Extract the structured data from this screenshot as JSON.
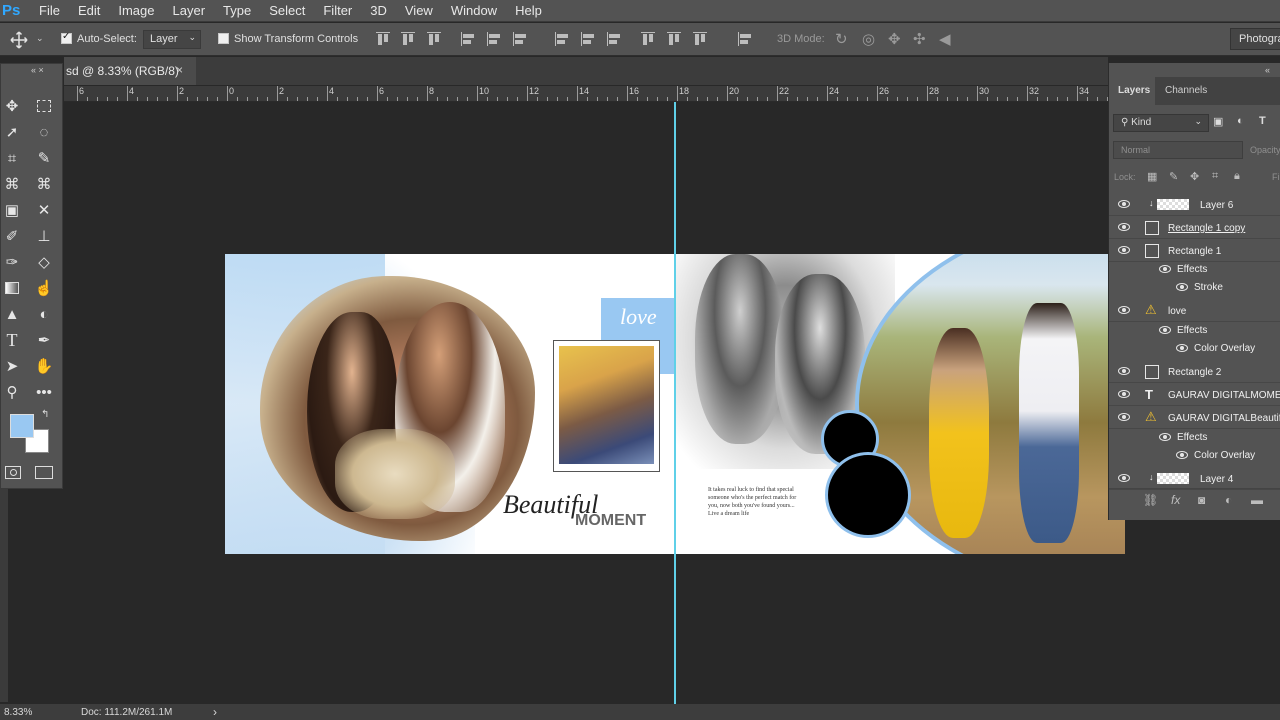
{
  "app": {
    "logo": "Ps"
  },
  "menu": [
    "File",
    "Edit",
    "Image",
    "Layer",
    "Type",
    "Select",
    "Filter",
    "3D",
    "View",
    "Window",
    "Help"
  ],
  "options": {
    "auto_select_label": "Auto-Select:",
    "auto_select_value": "Layer",
    "show_transform_label": "Show Transform Controls",
    "mode_3d_label": "3D Mode:",
    "workspace": "Photogra"
  },
  "document": {
    "tab_title": "sd @ 8.33% (RGB/8)",
    "tab_close": "×",
    "panel_collapse": "«",
    "toolbar_grip": "«  ×"
  },
  "ruler": [
    "6",
    "4",
    "2",
    "0",
    "2",
    "4",
    "6",
    "8",
    "10",
    "12",
    "14",
    "16",
    "18",
    "20",
    "22",
    "24",
    "26",
    "28",
    "30",
    "32",
    "34"
  ],
  "artwork": {
    "love": "love",
    "beautiful": "Beautiful",
    "moment": "MOMENT",
    "quote": "It takes real luck to find that special someone who's the perfect match for you, now both you've found yours... Live a dream life"
  },
  "layers_panel": {
    "tabs": [
      "Layers",
      "Channels"
    ],
    "kind_label": "Kind",
    "blend_mode": "Normal",
    "opacity_label": "Opacity",
    "lock_label": "Lock:",
    "fill_label": "Fi",
    "rows": [
      {
        "name": "Layer 6",
        "type": "image",
        "indent": 0
      },
      {
        "name": "Rectangle 1 copy",
        "type": "shape",
        "indent": 0
      },
      {
        "name": "Rectangle 1",
        "type": "shape",
        "indent": 0
      },
      {
        "name": "Effects",
        "type": "effects",
        "indent": 1
      },
      {
        "name": "Stroke",
        "type": "effect",
        "indent": 2
      },
      {
        "name": "love",
        "type": "warning",
        "indent": 0
      },
      {
        "name": "Effects",
        "type": "effects",
        "indent": 1
      },
      {
        "name": "Color Overlay",
        "type": "effect",
        "indent": 2
      },
      {
        "name": "Rectangle 2",
        "type": "shape",
        "indent": 0
      },
      {
        "name": "GAURAV DIGITALMOMENT",
        "type": "text",
        "indent": 0
      },
      {
        "name": "GAURAV DIGITALBeautiful",
        "type": "warning",
        "indent": 0
      },
      {
        "name": "Effects",
        "type": "effects",
        "indent": 1
      },
      {
        "name": "Color Overlay",
        "type": "effect",
        "indent": 2
      },
      {
        "name": "Layer 4",
        "type": "image",
        "indent": 0
      }
    ]
  },
  "status": {
    "zoom": "8.33%",
    "doc": "Doc: 111.2M/261.1M",
    "arrow": "›"
  },
  "colors": {
    "foreground": "#99c8f2",
    "background": "#ffffff",
    "guide": "#5fd0e8",
    "accent_blue": "#8fc0ec"
  }
}
